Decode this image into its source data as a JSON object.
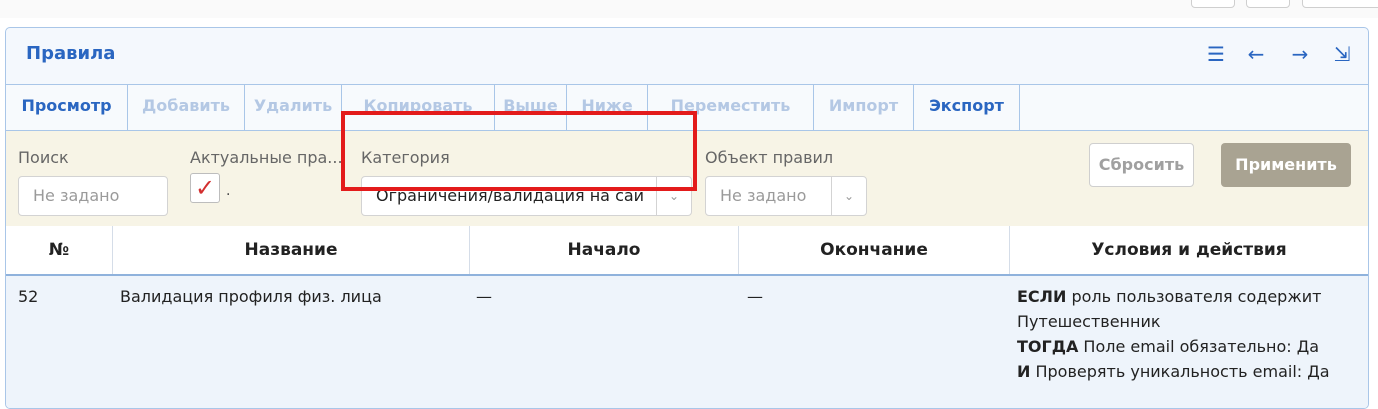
{
  "panel": {
    "title": "Правила",
    "tools": [
      {
        "icon": "list-icon",
        "glyph": "☰"
      },
      {
        "icon": "arrow-left-icon",
        "glyph": "←"
      },
      {
        "icon": "arrow-right-icon",
        "glyph": "→"
      },
      {
        "icon": "collapse-icon",
        "glyph": "⇲"
      }
    ]
  },
  "tabs": [
    "Просмотр",
    "Добавить",
    "Удалить",
    "Копировать",
    "Выше",
    "Ниже",
    "Переместить",
    "Импорт",
    "Экспорт"
  ],
  "filters": {
    "search_label": "Поиск",
    "search_placeholder": "Не задано",
    "actual_label": "Актуальные пра...",
    "actual_checked": true,
    "category_label": "Категория",
    "category_value": "Ограничения/валидация на сай",
    "object_label": "Объект правил",
    "object_placeholder": "Не задано",
    "reset_label": "Сбросить",
    "apply_label": "Применить"
  },
  "table": {
    "headers": [
      "№",
      "Название",
      "Начало",
      "Окончание",
      "Условия и действия"
    ],
    "rows": [
      {
        "num": "52",
        "name": "Валидация профиля физ. лица",
        "start": "—",
        "end": "—",
        "cond": {
          "if_kw": "ЕСЛИ",
          "if_text": " роль пользователя содержит",
          "if_text2": "Путешественник",
          "then_kw": "ТОГДА",
          "then_text": " Поле email обязательно: Да",
          "and_kw": "И",
          "and_text": " Проверять уникальность email: Да"
        }
      }
    ]
  },
  "colors": {
    "accent": "#2a66c1",
    "highlight": "#e31b1b",
    "apply": "#a9a392"
  }
}
